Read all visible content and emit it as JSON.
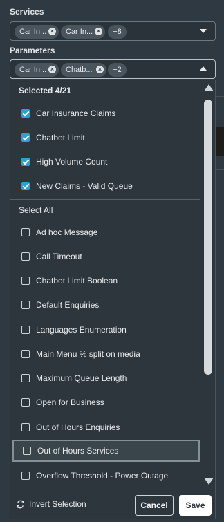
{
  "services": {
    "label": "Services",
    "chips": [
      "Car In...",
      "Car In..."
    ],
    "more": "+8"
  },
  "parameters": {
    "label": "Parameters",
    "chips": [
      "Car In...",
      "Chatb..."
    ],
    "more": "+2"
  },
  "dropdown": {
    "selected_count": "Selected 4/21",
    "selected_items": [
      "Car Insurance Claims",
      "Chatbot Limit",
      "High Volume Count",
      "New Claims - Valid Queue"
    ],
    "select_all": "Select All",
    "unselected_items": [
      "Ad hoc Message",
      "Call Timeout",
      "Chatbot Limit Boolean",
      "Default Enquiries",
      "Languages Enumeration",
      "Main Menu % split on media",
      "Maximum Queue Length",
      "Open for Business",
      "Out of Hours Enquiries",
      "Out of Hours Services",
      "Overflow Threshold - Power Outage"
    ],
    "highlighted_item": "Out of Hours Services",
    "invert_label": "Invert Selection",
    "cancel_label": "Cancel",
    "save_label": "Save"
  },
  "colors": {
    "background": "#2f3941",
    "checkbox_accent": "#29a3d3"
  },
  "icons": {
    "chip_remove": "close-circle-icon",
    "caret_down": "chevron-down-icon",
    "caret_up": "chevron-up-icon",
    "invert": "swap-icon"
  }
}
